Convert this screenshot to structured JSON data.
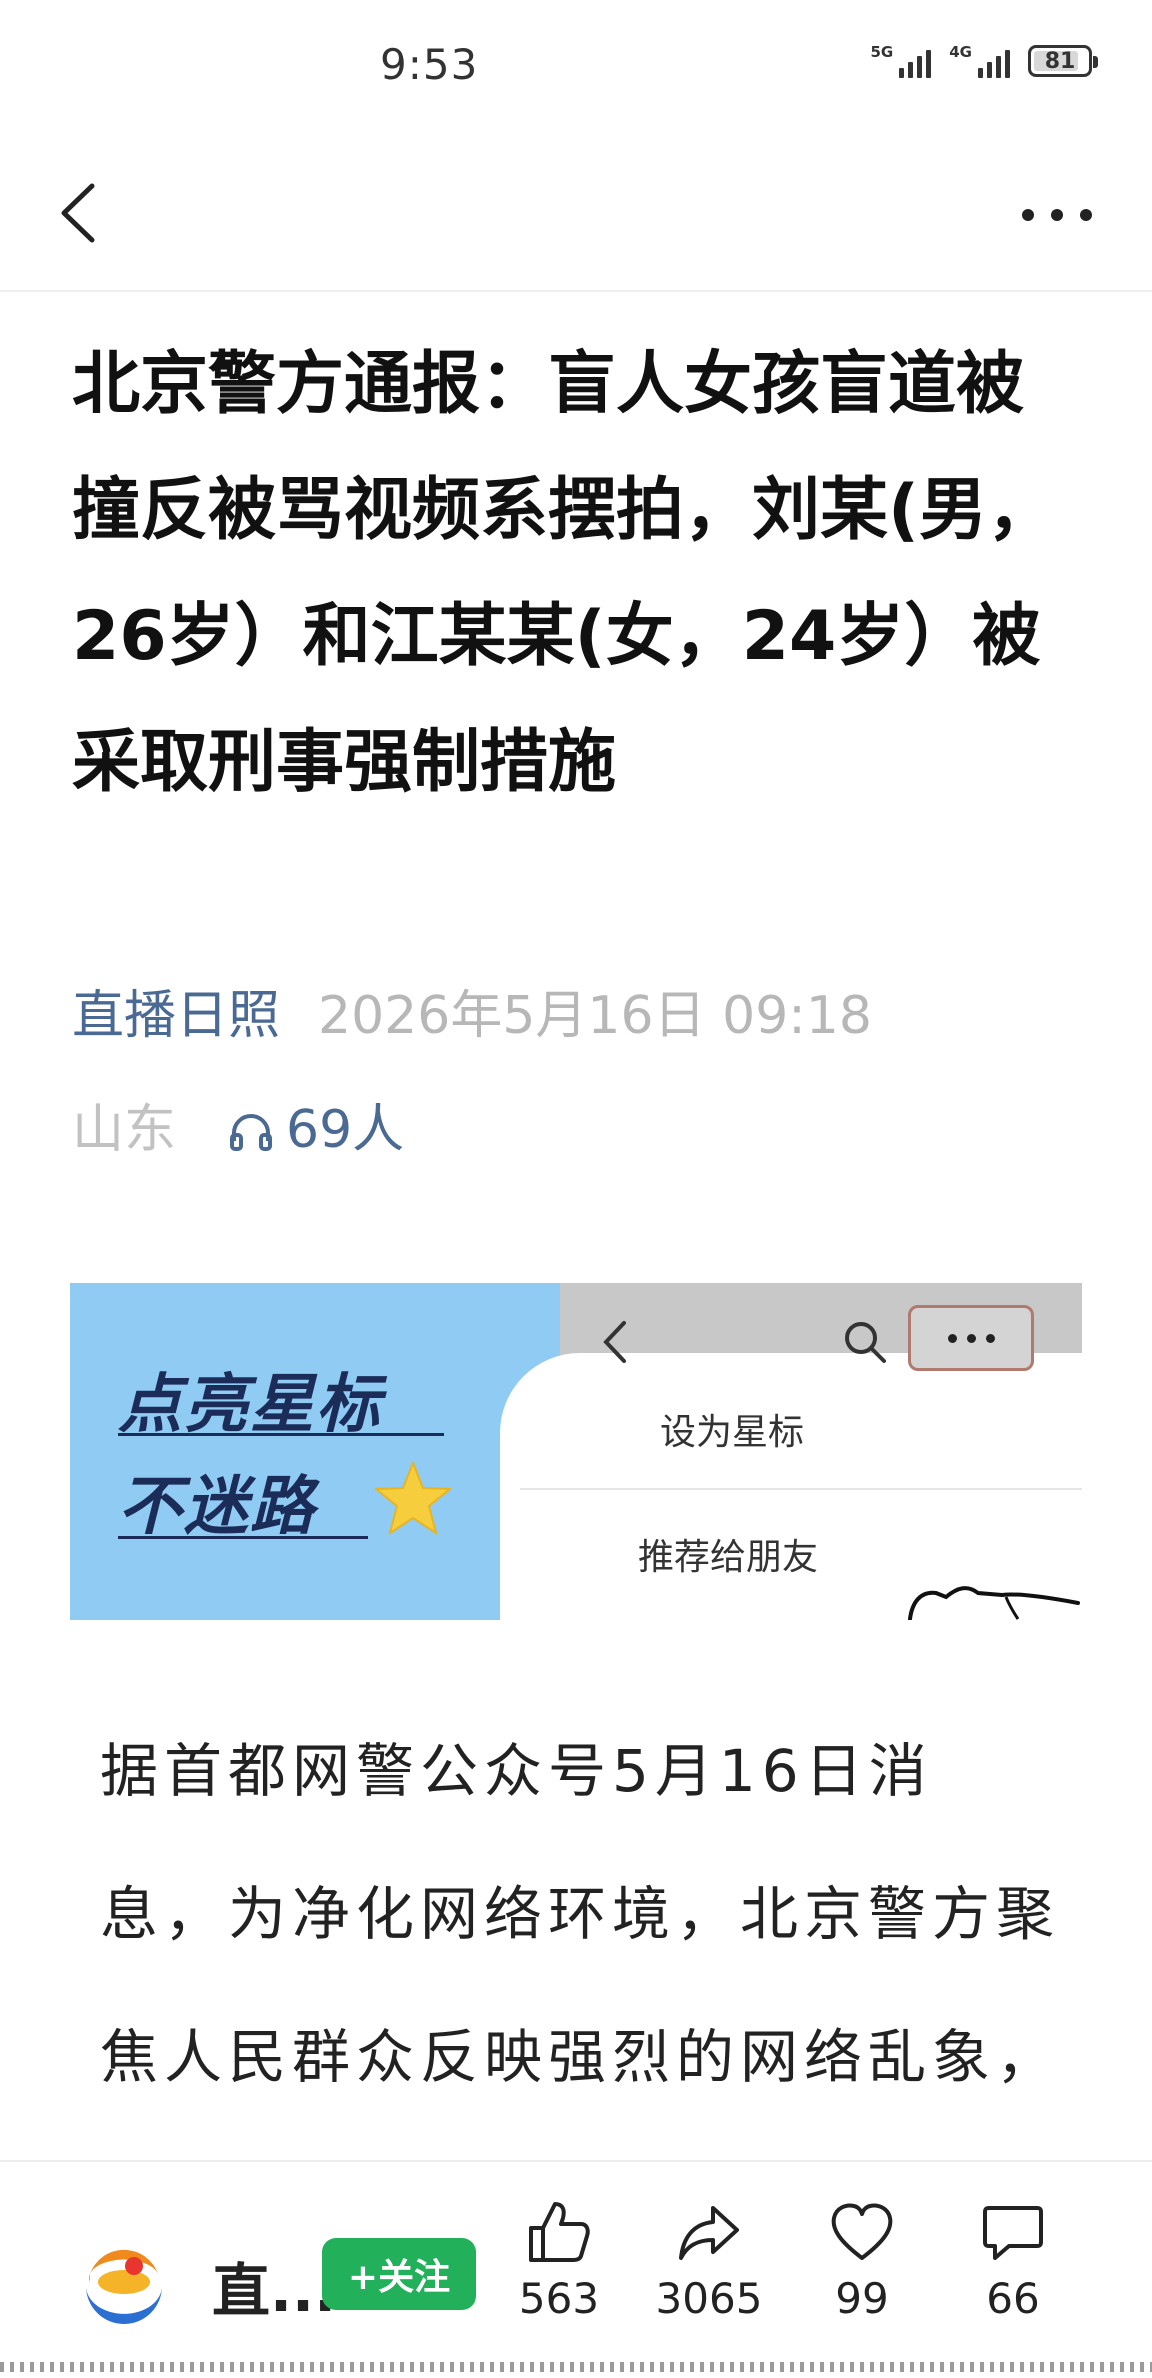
{
  "status": {
    "time": "9:53",
    "signal1_label": "5G",
    "signal2_label": "4G",
    "battery": "81"
  },
  "nav": {
    "back_icon": "chevron-left-icon",
    "more_icon": "more-dots-icon"
  },
  "article": {
    "title": "北京警方通报：盲人女孩盲道被撞反被骂视频系摆拍，刘某(男，26岁）和江某某(女，24岁）被采取刑事强制措施",
    "source": "直播日照",
    "datetime": "2026年5月16日 09:18",
    "region": "山东",
    "listeners": "69人",
    "body": "据首都网警公众号5月16日消息，为净化网络环境，北京警方聚焦人民群众反映强烈的网络乱象，持续加大打击整治力"
  },
  "banner": {
    "line1": "点亮星标",
    "line2": "不迷路",
    "menu_item_1": "设为星标",
    "menu_item_2": "推荐给朋友"
  },
  "bottom_bar": {
    "account_name": "直...",
    "follow_label": "+关注",
    "likes": "563",
    "shares": "3065",
    "favorites": "99",
    "comments": "66"
  },
  "colors": {
    "source_blue": "#4a6a93",
    "follow_green": "#23b05a",
    "banner_blue": "#8fcbf3"
  }
}
